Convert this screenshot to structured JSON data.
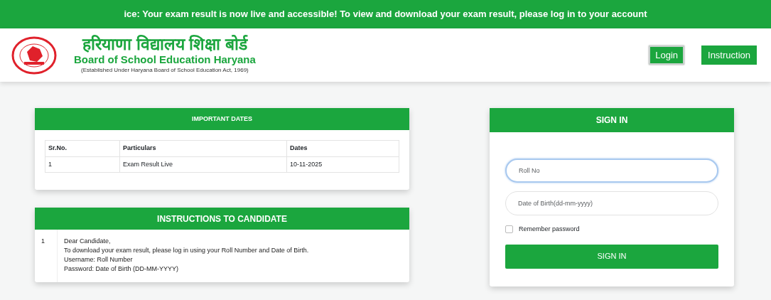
{
  "notice": "ice: Your exam result is now live and accessible! To view and download your exam result, please log in to your account",
  "header": {
    "title_hindi": "हरियाणा विद्यालय शिक्षा बोर्ड",
    "title": "Board of School Education Haryana",
    "subtitle": "(Established Under Haryana Board of School Education Act, 1969)",
    "nav": [
      {
        "label": "Login",
        "selected": true
      },
      {
        "label": "Instruction",
        "selected": false
      }
    ]
  },
  "important_dates": {
    "title": "IMPORTANT DATES",
    "columns": [
      "Sr.No.",
      "Particulars",
      "Dates"
    ],
    "rows": [
      [
        "1",
        "Exam Result Live",
        "10-11-2025"
      ]
    ]
  },
  "instructions": {
    "title": "INSTRUCTIONS TO CANDIDATE",
    "items": [
      {
        "number": "1",
        "lines": [
          "Dear Candidate,",
          "To download your exam result, please log in using your Roll Number and Date of Birth.",
          "Username: Roll Number",
          "Password: Date of Birth (DD-MM-YYYY)"
        ]
      }
    ]
  },
  "sign_in": {
    "title": "SIGN IN",
    "fields": [
      {
        "placeholder": "Roll No",
        "focused": true
      },
      {
        "placeholder": "Date of Birth(dd-mm-yyyy)",
        "focused": false
      }
    ],
    "remember": {
      "label": "Remember password",
      "checked": false
    },
    "button": "SIGN IN"
  }
}
